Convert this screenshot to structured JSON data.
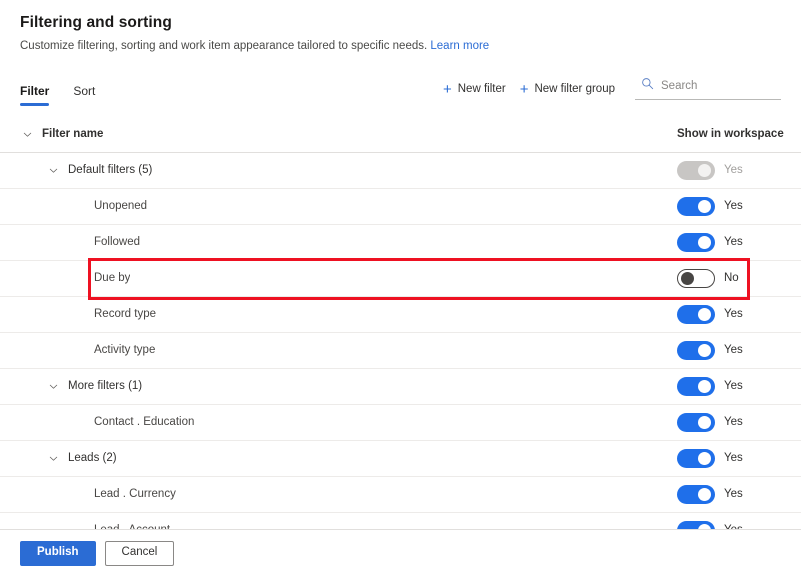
{
  "header": {
    "title": "Filtering and sorting",
    "subtitle": "Customize filtering, sorting and work item appearance tailored to specific needs.",
    "learn_more": "Learn more"
  },
  "tabs": [
    {
      "label": "Filter",
      "active": true
    },
    {
      "label": "Sort",
      "active": false
    }
  ],
  "toolbar": {
    "new_filter": "New filter",
    "new_filter_group": "New filter group",
    "plus_icon": "plus-icon",
    "search_icon": "search-icon",
    "search_placeholder": "Search",
    "search_value": ""
  },
  "table": {
    "columns": {
      "name": "Filter name",
      "toggle": "Show in workspace"
    },
    "rows": [
      {
        "label": "Default filters (5)",
        "level": "group",
        "chevron": "chevron-down-icon",
        "toggle_state": "disabled",
        "toggle_label": "Yes",
        "highlighted": false
      },
      {
        "label": "Unopened",
        "level": "child",
        "chevron": "",
        "toggle_state": "on",
        "toggle_label": "Yes",
        "highlighted": false
      },
      {
        "label": "Followed",
        "level": "child",
        "chevron": "",
        "toggle_state": "on",
        "toggle_label": "Yes",
        "highlighted": false
      },
      {
        "label": "Due by",
        "level": "child",
        "chevron": "",
        "toggle_state": "off",
        "toggle_label": "No",
        "highlighted": true
      },
      {
        "label": "Record type",
        "level": "child",
        "chevron": "",
        "toggle_state": "on",
        "toggle_label": "Yes",
        "highlighted": false
      },
      {
        "label": "Activity type",
        "level": "child",
        "chevron": "",
        "toggle_state": "on",
        "toggle_label": "Yes",
        "highlighted": false
      },
      {
        "label": "More filters (1)",
        "level": "group",
        "chevron": "chevron-down-icon",
        "toggle_state": "on",
        "toggle_label": "Yes",
        "highlighted": false
      },
      {
        "label": "Contact . Education",
        "level": "child",
        "chevron": "",
        "toggle_state": "on",
        "toggle_label": "Yes",
        "highlighted": false
      },
      {
        "label": "Leads (2)",
        "level": "group",
        "chevron": "chevron-down-icon",
        "toggle_state": "on",
        "toggle_label": "Yes",
        "highlighted": false
      },
      {
        "label": "Lead . Currency",
        "level": "child",
        "chevron": "",
        "toggle_state": "on",
        "toggle_label": "Yes",
        "highlighted": false
      },
      {
        "label": "Lead . Account",
        "level": "child",
        "chevron": "",
        "toggle_state": "on",
        "toggle_label": "Yes",
        "highlighted": false
      }
    ]
  },
  "footer": {
    "publish": "Publish",
    "cancel": "Cancel"
  },
  "colors": {
    "accent": "#2b6cd4",
    "toggle_on": "#1f6fea",
    "toggle_disabled": "#c8c6c4",
    "highlight": "#ee1122",
    "link": "#2b6cd4"
  }
}
